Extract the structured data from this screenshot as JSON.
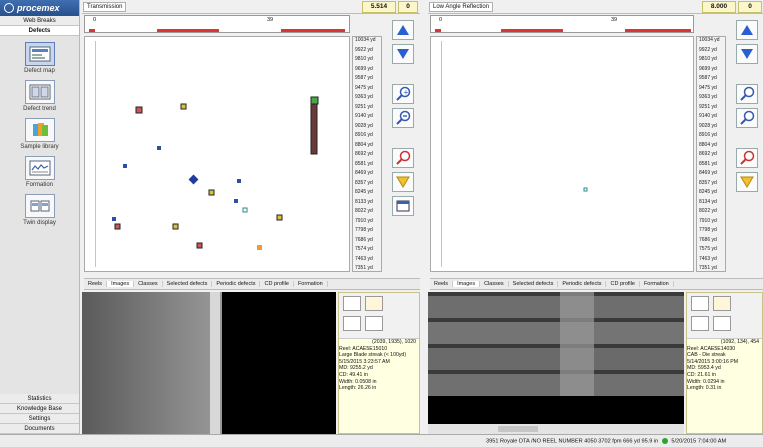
{
  "app": {
    "brand": "procemex"
  },
  "sidebar": {
    "top_buttons": [
      "Web Breaks",
      "Defects"
    ],
    "tools": [
      {
        "label": "Defect map",
        "icon": "defect-map-icon"
      },
      {
        "label": "Defect trend",
        "icon": "defect-trend-icon"
      },
      {
        "label": "Sample library",
        "icon": "sample-library-icon"
      },
      {
        "label": "Formation",
        "icon": "formation-icon"
      },
      {
        "label": "Twin display",
        "icon": "twin-display-icon"
      }
    ],
    "bottom_buttons": [
      "Statistics",
      "Knowledge Base",
      "Settings",
      "Documents"
    ]
  },
  "left_panel": {
    "title": "Transmission",
    "value": "5.514",
    "count": "0",
    "ruler_left": "0",
    "ruler_mid": "39",
    "yd_labels": [
      "10034 yd",
      "9922 yd",
      "9810 yd",
      "9699 yd",
      "9587 yd",
      "9475 yd",
      "9363 yd",
      "9251 yd",
      "9140 yd",
      "9028 yd",
      "8916 yd",
      "8804 yd",
      "8692 yd",
      "8581 yd",
      "8469 yd",
      "8357 yd",
      "8245 yd",
      "8133 yd",
      "8022 yd",
      "7910 yd",
      "7798 yd",
      "7686 yd",
      "7574 yd",
      "7463 yd",
      "7351 yd"
    ],
    "tabs": [
      "Reels",
      "Images",
      "Classes",
      "Selected defects",
      "Periodic defects",
      "CD profile",
      "Formation"
    ],
    "info": {
      "coords": "(2039, 1935), 1020",
      "lines": [
        "Reel: ACAE5E15010",
        "Large Blade streak (< 100yd)",
        "5/15/2015 3:23:57 AM",
        "MD: 9255.2 yd",
        "CD: 49.41 in",
        "Width: 0.0508 in",
        "Length: 26.26 in"
      ]
    }
  },
  "right_panel": {
    "title": "Low Angle Reflection",
    "value": "8.000",
    "count": "0",
    "ruler_left": "0",
    "ruler_mid": "39",
    "yd_labels": [
      "10034 yd",
      "9922 yd",
      "9810 yd",
      "9699 yd",
      "9587 yd",
      "9475 yd",
      "9363 yd",
      "9251 yd",
      "9140 yd",
      "9028 yd",
      "8916 yd",
      "8804 yd",
      "8692 yd",
      "8581 yd",
      "8469 yd",
      "8357 yd",
      "8245 yd",
      "8134 yd",
      "8022 yd",
      "7910 yd",
      "7798 yd",
      "7686 yd",
      "7575 yd",
      "7463 yd",
      "7351 yd"
    ],
    "tabs": [
      "Reels",
      "Images",
      "Classes",
      "Selected defects",
      "Periodic defects",
      "CD profile",
      "Formation"
    ],
    "info": {
      "coords": "(1092, 134), 454",
      "lines": [
        "Reel: ACAE5E14030",
        "CAB - Die streak",
        "5/14/2015 3:00:16 PM",
        "MD: 5953.4 yd",
        "CD: 21.61 in",
        "Width: 0.0294 in",
        "Length: 0.31 in"
      ]
    }
  },
  "status_bar": {
    "text": "3951 Royale DTA /NO REEL NUMBER 4050 3702 fpm 666 yd 95.9 in",
    "time": "5/20/2015 7:04:00 AM"
  }
}
